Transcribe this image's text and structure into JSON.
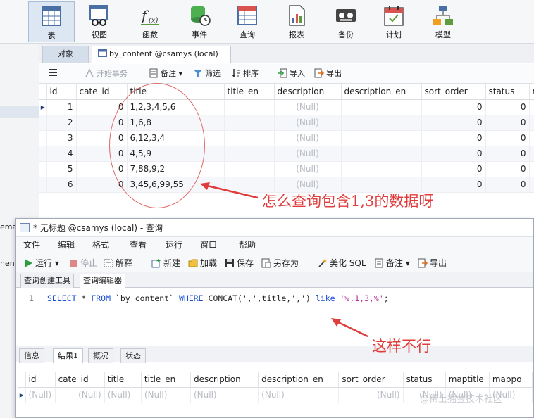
{
  "toolbar": {
    "buttons": [
      {
        "label": "表",
        "icon": "table-icon"
      },
      {
        "label": "视图",
        "icon": "view-icon"
      },
      {
        "label": "函数",
        "icon": "function-icon"
      },
      {
        "label": "事件",
        "icon": "event-icon"
      },
      {
        "label": "查询",
        "icon": "query-icon"
      },
      {
        "label": "报表",
        "icon": "report-icon"
      },
      {
        "label": "备份",
        "icon": "backup-icon"
      },
      {
        "label": "计划",
        "icon": "schedule-icon"
      },
      {
        "label": "模型",
        "icon": "model-icon"
      }
    ]
  },
  "left": {
    "texts": [
      "ema",
      "hen"
    ]
  },
  "tabs": {
    "objects": "对象",
    "content": "by_content @csamys (local) ..."
  },
  "grid_toolbar": {
    "begin_transaction": "开始事务",
    "memo": "备注",
    "filter": "筛选",
    "sort": "排序",
    "import": "导入",
    "export": "导出"
  },
  "grid": {
    "columns": [
      "id",
      "cate_id",
      "title",
      "title_en",
      "description",
      "description_en",
      "sort_order",
      "status",
      "r"
    ],
    "rows": [
      {
        "id": "1",
        "cate_id": "0",
        "title": "1,2,3,4,5,6",
        "title_en": "",
        "description": "(Null)",
        "description_en": "",
        "sort_order": "0",
        "status": "0"
      },
      {
        "id": "2",
        "cate_id": "0",
        "title": "1,6,8",
        "title_en": "",
        "description": "(Null)",
        "description_en": "",
        "sort_order": "0",
        "status": "0"
      },
      {
        "id": "3",
        "cate_id": "0",
        "title": "6,12,3,4",
        "title_en": "",
        "description": "(Null)",
        "description_en": "",
        "sort_order": "0",
        "status": "0"
      },
      {
        "id": "4",
        "cate_id": "0",
        "title": "4,5,9",
        "title_en": "",
        "description": "(Null)",
        "description_en": "",
        "sort_order": "0",
        "status": "0"
      },
      {
        "id": "5",
        "cate_id": "0",
        "title": "7,88,9,2",
        "title_en": "",
        "description": "(Null)",
        "description_en": "",
        "sort_order": "0",
        "status": "0"
      },
      {
        "id": "6",
        "cate_id": "0",
        "title": "3,45,6,99,55",
        "title_en": "",
        "description": "(Null)",
        "description_en": "",
        "sort_order": "0",
        "status": "0"
      }
    ]
  },
  "annotations": {
    "question": "怎么查询包含1,3的数据呀",
    "not_working": "这样不行"
  },
  "query_window": {
    "title": "* 无标题 @csamys (local) - 查询",
    "menu": [
      "文件",
      "编辑",
      "格式",
      "查看",
      "运行",
      "窗口",
      "帮助"
    ],
    "tools": {
      "run": "运行",
      "stop": "停止",
      "explain": "解释",
      "new": "新建",
      "load": "加载",
      "save": "保存",
      "save_as": "另存为",
      "beautify": "美化 SQL",
      "memo": "备注",
      "export": "导出"
    },
    "editor_tabs": [
      "查询创建工具",
      "查询编辑器"
    ],
    "editor": {
      "line_number": "1",
      "sql_tokens": [
        {
          "t": "SELECT",
          "k": "kw"
        },
        {
          "t": " * ",
          "k": ""
        },
        {
          "t": "FROM",
          "k": "kw"
        },
        {
          "t": " `by_content` ",
          "k": ""
        },
        {
          "t": "WHERE",
          "k": "kw"
        },
        {
          "t": " CONCAT(',',title,',') ",
          "k": ""
        },
        {
          "t": "like",
          "k": "kw"
        },
        {
          "t": " ",
          "k": ""
        },
        {
          "t": "'%,1,3,%'",
          "k": "str"
        },
        {
          "t": ";",
          "k": ""
        }
      ]
    },
    "result_tabs": [
      "信息",
      "结果1",
      "概况",
      "状态"
    ],
    "result_columns": [
      "id",
      "cate_id",
      "title",
      "title_en",
      "description",
      "description_en",
      "sort_order",
      "status",
      "maptitle",
      "mappo"
    ],
    "result_row": [
      "(Null)",
      "(Null)",
      "(Null)",
      "(Null)",
      "(Null)",
      "(Null)",
      "(Null)",
      "(Null)",
      "(Null)",
      "(Null)"
    ]
  },
  "watermark": "@稀土掘金技术社区",
  "colors": {
    "annotation": "#e03c3c",
    "keyword": "#1c4fd8",
    "string": "#b0309a"
  }
}
